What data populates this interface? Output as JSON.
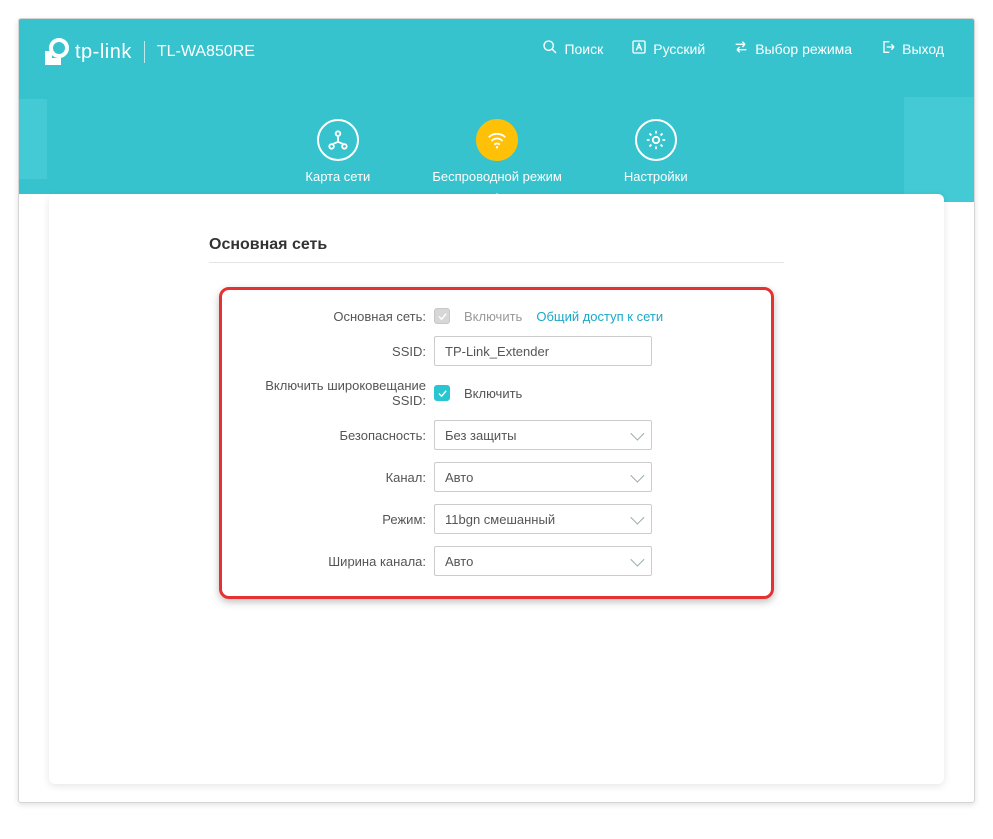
{
  "header": {
    "brand": "tp-link",
    "model": "TL-WA850RE",
    "actions": {
      "search": "Поиск",
      "language": "Русский",
      "mode": "Выбор режима",
      "logout": "Выход"
    }
  },
  "nav": {
    "map": "Карта сети",
    "wireless": "Беспроводной режим",
    "settings": "Настройки"
  },
  "section": {
    "title": "Основная сеть"
  },
  "form": {
    "host_network": {
      "label": "Основная сеть:",
      "enable": "Включить",
      "share": "Общий доступ к сети"
    },
    "ssid": {
      "label": "SSID:",
      "value": "TP-Link_Extender"
    },
    "broadcast": {
      "label": "Включить широковещание SSID:",
      "enable": "Включить"
    },
    "security": {
      "label": "Безопасность:",
      "value": "Без защиты"
    },
    "channel": {
      "label": "Канал:",
      "value": "Авто"
    },
    "mode": {
      "label": "Режим:",
      "value": "11bgn смешанный"
    },
    "channel_width": {
      "label": "Ширина канала:",
      "value": "Авто"
    }
  }
}
